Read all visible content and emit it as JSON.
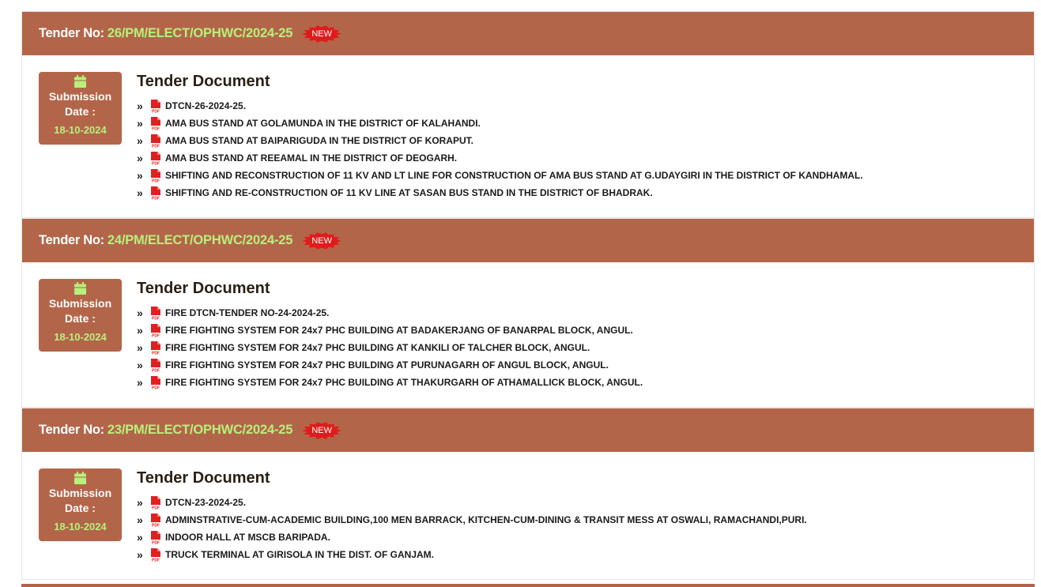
{
  "colors": {
    "header_bg": "#b3654a",
    "tender_no": "#b7f07a",
    "new_badge": "#e01b1b"
  },
  "labels": {
    "tender_no_prefix": "Tender No:",
    "new_badge": "NEW",
    "submission": "Submission",
    "date_label": "Date :",
    "doc_section_title": "Tender Document"
  },
  "tenders": [
    {
      "number": "26/PM/ELECT/OPHWC/2024-25",
      "submission_date": "18-10-2024",
      "documents": [
        "DTCN-26-2024-25.",
        "AMA BUS STAND AT GOLAMUNDA IN THE DISTRICT OF KALAHANDI.",
        "AMA BUS STAND AT BAIPARIGUDA IN THE DISTRICT OF KORAPUT.",
        "AMA BUS STAND AT REEAMAL IN THE DISTRICT OF DEOGARH.",
        "SHIFTING AND RECONSTRUCTION OF 11 KV AND LT LINE FOR CONSTRUCTION OF AMA BUS STAND AT G.UDAYGIRI IN THE DISTRICT OF KANDHAMAL.",
        "SHIFTING AND RE-CONSTRUCTION OF 11 KV LINE AT SASAN BUS STAND IN THE DISTRICT OF BHADRAK."
      ]
    },
    {
      "number": "24/PM/ELECT/OPHWC/2024-25",
      "submission_date": "18-10-2024",
      "documents": [
        "FIRE DTCN-TENDER NO-24-2024-25.",
        "FIRE FIGHTING SYSTEM FOR 24x7 PHC BUILDING AT BADAKERJANG OF BANARPAL BLOCK, ANGUL.",
        "FIRE FIGHTING SYSTEM FOR 24x7 PHC BUILDING AT KANKILI OF TALCHER BLOCK, ANGUL.",
        "FIRE FIGHTING SYSTEM FOR 24x7 PHC BUILDING AT PURUNAGARH OF ANGUL BLOCK, ANGUL.",
        "FIRE FIGHTING SYSTEM FOR 24x7 PHC BUILDING AT THAKURGARH OF ATHAMALLICK BLOCK, ANGUL."
      ]
    },
    {
      "number": "23/PM/ELECT/OPHWC/2024-25",
      "submission_date": "18-10-2024",
      "documents": [
        "DTCN-23-2024-25.",
        "ADMINSTRATIVE-CUM-ACADEMIC BUILDING,100 MEN BARRACK, KITCHEN-CUM-DINING & TRANSIT MESS AT OSWALI, RAMACHANDI,PURI.",
        "INDOOR HALL AT MSCB BARIPADA.",
        "TRUCK TERMINAL AT GIRISOLA IN THE DIST. OF GANJAM."
      ]
    }
  ]
}
